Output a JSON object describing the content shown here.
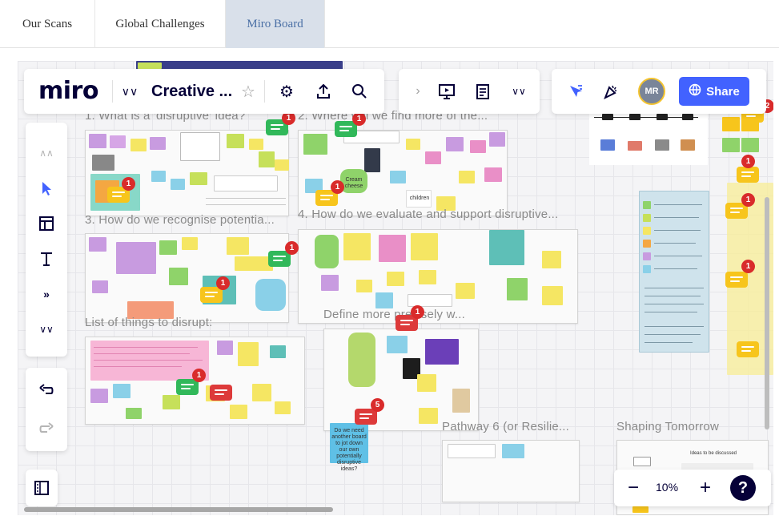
{
  "site_tabs": [
    {
      "label": "Our Scans"
    },
    {
      "label": "Global Challenges"
    },
    {
      "label": "Miro Board"
    }
  ],
  "toolbar": {
    "logo": "miro",
    "board_name": "Creative ...",
    "share_label": "Share",
    "avatar_initials": "MR"
  },
  "frames": {
    "f1": "1. What is a 'disruptive' idea?",
    "f2": "2. Where will we find more of the...",
    "f3": "3. How do we recognise potentia...",
    "f4": "4. How do we evaluate and support disruptive...",
    "f5": "List of things to disrupt:",
    "f6": "Define more precisely w...",
    "f7": "Pathway 6 (or Resilie...",
    "f8": "Shaping Tomorrow"
  },
  "badges": {
    "b1": "1",
    "b2": "1",
    "b3": "1",
    "b4": "1",
    "b5": "1",
    "b6": "1",
    "b7": "1",
    "b8": "1",
    "b9": "5",
    "b10": "2",
    "b11": "1",
    "b12": "1",
    "b13": "1"
  },
  "sticky_texts": {
    "cream": "Cream cheese",
    "children": "children",
    "doyouneed": "Do we need another board to jot down our own potentially disruptive ideas?",
    "ideas": "Ideas to be discussed"
  },
  "zoom": {
    "value": "10%",
    "help": "?"
  },
  "colors": {
    "accent": "#4262ff",
    "badge": "#d92b2b",
    "active_tab": "#d9e0ea"
  }
}
